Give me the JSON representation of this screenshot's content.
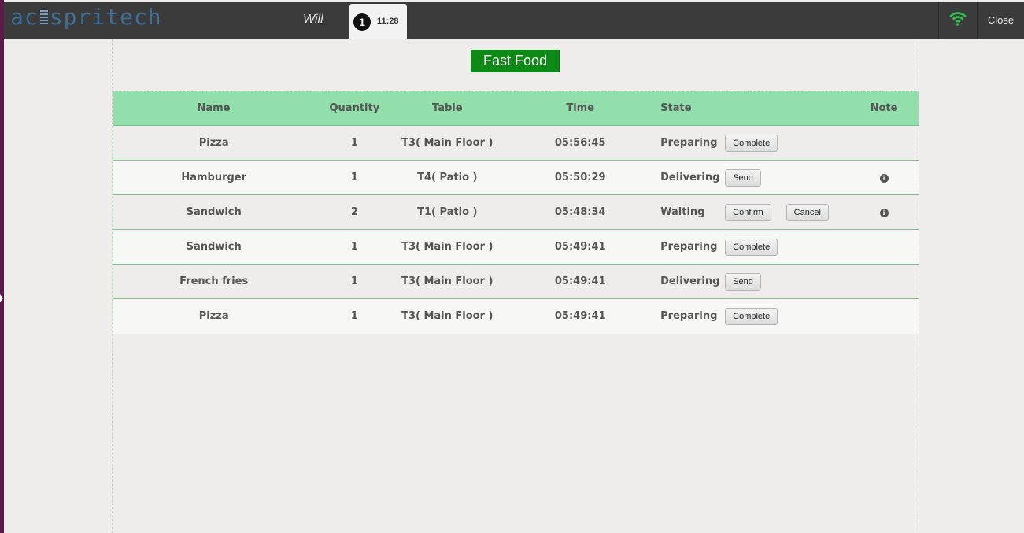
{
  "header": {
    "logo_text": "acespritech",
    "user_name": "Will",
    "order_count": "1",
    "clock": "11:28",
    "close_label": "Close",
    "wifi_color": "#2ec247"
  },
  "section": {
    "title": "Fast Food"
  },
  "table": {
    "columns": [
      "Name",
      "Quantity",
      "Table",
      "Time",
      "State",
      "Note"
    ],
    "rows": [
      {
        "name": "Pizza",
        "quantity": "1",
        "table": "T3( Main Floor )",
        "time": "05:56:45",
        "state": "Preparing",
        "buttons": [
          "Complete"
        ],
        "note": false
      },
      {
        "name": "Hamburger",
        "quantity": "1",
        "table": "T4( Patio )",
        "time": "05:50:29",
        "state": "Delivering",
        "buttons": [
          "Send"
        ],
        "note": true
      },
      {
        "name": "Sandwich",
        "quantity": "2",
        "table": "T1( Patio )",
        "time": "05:48:34",
        "state": "Waiting",
        "buttons": [
          "Confirm",
          "Cancel"
        ],
        "note": true
      },
      {
        "name": "Sandwich",
        "quantity": "1",
        "table": "T3( Main Floor )",
        "time": "05:49:41",
        "state": "Preparing",
        "buttons": [
          "Complete"
        ],
        "note": false
      },
      {
        "name": "French fries",
        "quantity": "1",
        "table": "T3( Main Floor )",
        "time": "05:49:41",
        "state": "Delivering",
        "buttons": [
          "Send"
        ],
        "note": false
      },
      {
        "name": "Pizza",
        "quantity": "1",
        "table": "T3( Main Floor )",
        "time": "05:49:41",
        "state": "Preparing",
        "buttons": [
          "Complete"
        ],
        "note": false
      }
    ]
  },
  "colors": {
    "header_bg": "#3b3b3b",
    "table_header_bg": "#93dfac",
    "title_bg": "#0d8a16"
  }
}
